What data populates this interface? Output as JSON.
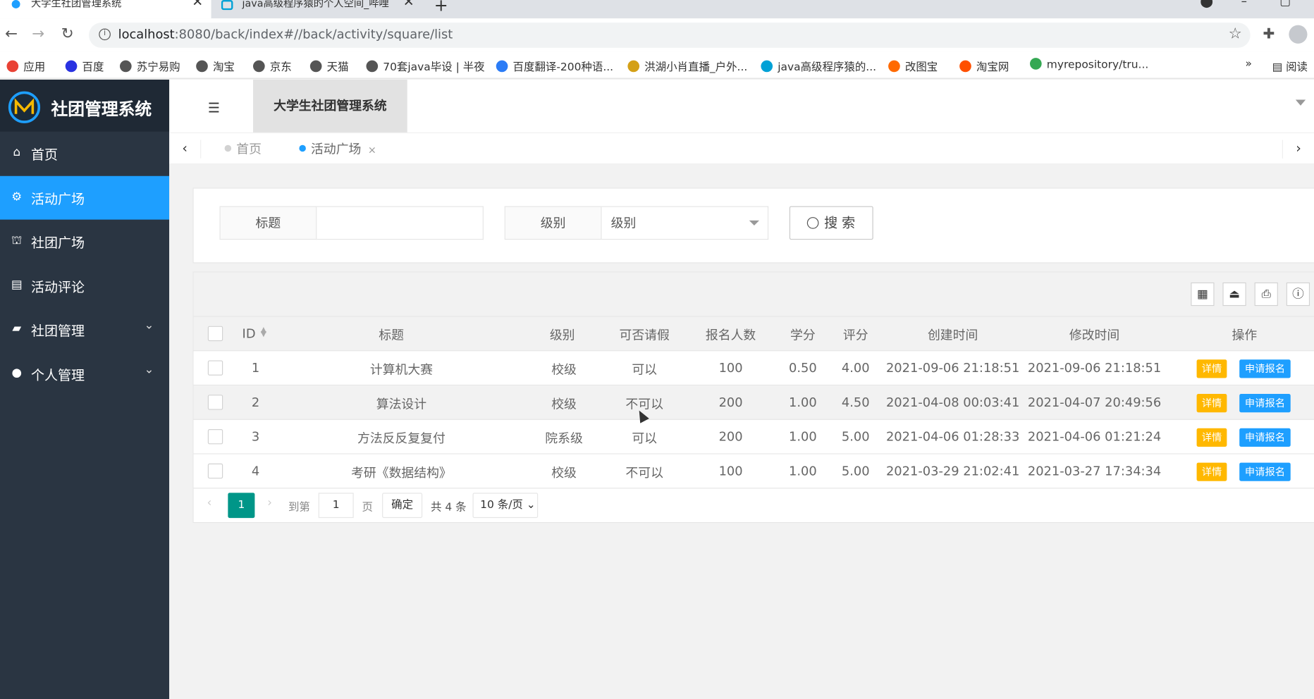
{
  "browser": {
    "tabs": [
      {
        "title": "大学生社团管理系统",
        "close": "✕"
      },
      {
        "title": "java高级程序猿的个人空间_哔哩",
        "close": "✕"
      }
    ],
    "new_tab": "+",
    "url_host": "localhost",
    "url_path": ":8080/back/index#//back/activity/square/list",
    "bookmarks": [
      {
        "label": "应用",
        "color": "#e94235"
      },
      {
        "label": "百度",
        "color": "#2932e1"
      },
      {
        "label": "苏宁易购",
        "color": "#555555"
      },
      {
        "label": "淘宝",
        "color": "#555555"
      },
      {
        "label": "京东",
        "color": "#555555"
      },
      {
        "label": "天猫",
        "color": "#555555"
      },
      {
        "label": "70套java毕设 | 半夜",
        "color": "#555555"
      },
      {
        "label": "百度翻译-200种语...",
        "color": "#2b7cf6"
      },
      {
        "label": "洪湖小肖直播_户外...",
        "color": "#d4a017"
      },
      {
        "label": "java高级程序猿的...",
        "color": "#00a1d6"
      },
      {
        "label": "改图宝",
        "color": "#ff6a00"
      },
      {
        "label": "淘宝网",
        "color": "#ff5000"
      },
      {
        "label": "myrepository/tru...",
        "color": "#34a853"
      }
    ],
    "bookmarks_more": "»",
    "reading_list": "阅读"
  },
  "app": {
    "logo_text": "社团管理系统",
    "header_title": "大学生社团管理系统",
    "accent_color": "#1e9fff",
    "sidebar": [
      {
        "label": "首页",
        "icon": "home-icon",
        "glyph": "⌂",
        "active": false,
        "expandable": false
      },
      {
        "label": "活动广场",
        "icon": "motorcycle-icon",
        "glyph": "⚙",
        "active": true,
        "expandable": false
      },
      {
        "label": "社团广场",
        "icon": "bank-icon",
        "glyph": "⛫",
        "active": false,
        "expandable": false
      },
      {
        "label": "活动评论",
        "icon": "list-icon",
        "glyph": "▤",
        "active": false,
        "expandable": false
      },
      {
        "label": "社团管理",
        "icon": "book-icon",
        "glyph": "▰",
        "active": false,
        "expandable": true
      },
      {
        "label": "个人管理",
        "icon": "user-icon",
        "glyph": "●",
        "active": false,
        "expandable": true
      }
    ],
    "page_tabs": [
      {
        "label": "首页",
        "active": false
      },
      {
        "label": "活动广场",
        "active": true,
        "close": "×"
      }
    ],
    "search": {
      "title_label": "标题",
      "title_value": "",
      "level_label": "级别",
      "level_value": "级别",
      "button_label": "搜 索"
    },
    "table": {
      "columns": [
        "ID",
        "标题",
        "级别",
        "可否请假",
        "报名人数",
        "学分",
        "评分",
        "创建时间",
        "修改时间",
        "操作"
      ],
      "rows": [
        {
          "id": "1",
          "title": "计算机大赛",
          "level": "校级",
          "leave": "可以",
          "count": "100",
          "credit": "0.50",
          "score": "4.00",
          "created": "2021-09-06 21:18:51",
          "modified": "2021-09-06 21:18:51"
        },
        {
          "id": "2",
          "title": "算法设计",
          "level": "校级",
          "leave": "不可以",
          "count": "200",
          "credit": "1.00",
          "score": "4.50",
          "created": "2021-04-08 00:03:41",
          "modified": "2021-04-07 20:49:56"
        },
        {
          "id": "3",
          "title": "方法反反复复付",
          "level": "院系级",
          "leave": "可以",
          "count": "200",
          "credit": "1.00",
          "score": "5.00",
          "created": "2021-04-06 01:28:33",
          "modified": "2021-04-06 01:21:24"
        },
        {
          "id": "4",
          "title": "考研《数据结构》",
          "level": "校级",
          "leave": "不可以",
          "count": "100",
          "credit": "1.00",
          "score": "5.00",
          "created": "2021-03-29 21:02:41",
          "modified": "2021-03-27 17:34:34"
        }
      ],
      "detail_label": "详情",
      "apply_label": "申请报名"
    },
    "pager": {
      "current": "1",
      "goto_label": "到第",
      "goto_value": "1",
      "page_unit": "页",
      "confirm": "确定",
      "total": "共 4 条",
      "page_size": "10 条/页"
    }
  }
}
